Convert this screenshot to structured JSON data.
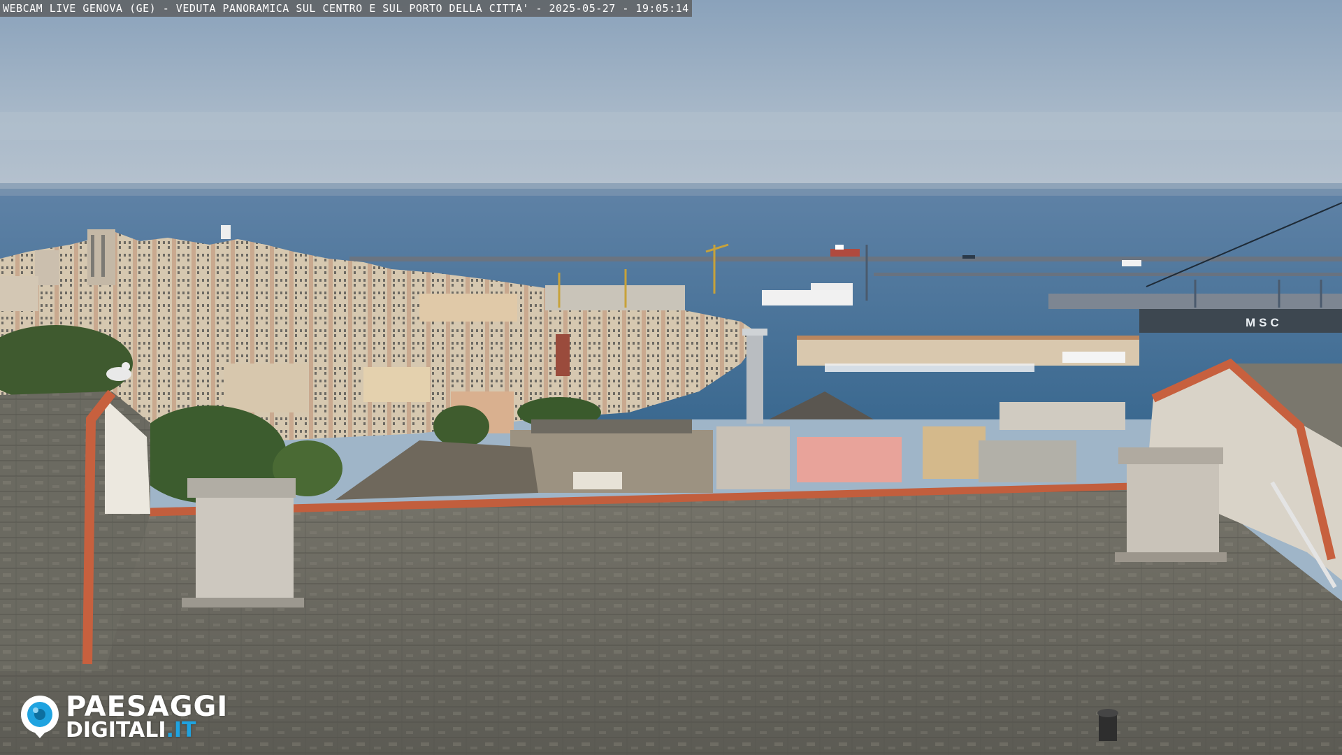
{
  "overlay": {
    "caption": "WEBCAM LIVE GENOVA (GE) - VEDUTA PANORAMICA SUL CENTRO E SUL PORTO DELLA CITTA' - 2025-05-27 - 19:05:14"
  },
  "logo": {
    "line1": "PAESAGGI",
    "line2_main": "DIGITALI",
    "line2_tld": ".IT",
    "accent_color": "#1fa3e0"
  },
  "ship_marking": "MSC",
  "colors": {
    "sky_top": "#8ea7c0",
    "sea": "#3f6a93",
    "roof": "#6c6a60",
    "roof_edge": "#c9603f",
    "city": "#d9cbb3"
  }
}
